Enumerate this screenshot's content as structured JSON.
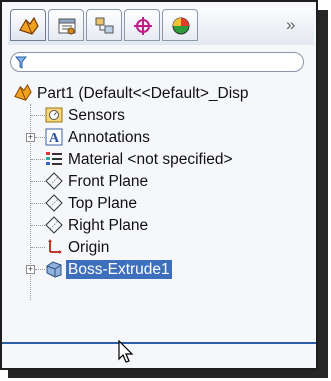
{
  "tabs": [
    {
      "icon": "featuremanager-tree-icon",
      "active": true
    },
    {
      "icon": "propertymanager-icon",
      "active": false
    },
    {
      "icon": "configurationmanager-icon",
      "active": false
    },
    {
      "icon": "dimxpertmanager-icon",
      "active": false
    },
    {
      "icon": "displaymanager-icon",
      "active": false
    }
  ],
  "tab_more": "»",
  "filter": {
    "placeholder": "",
    "icon": "filter-icon"
  },
  "tree": {
    "root": {
      "label": "Part1  (Default<<Default>_Disp",
      "icon": "part-icon"
    },
    "items": [
      {
        "label": "Sensors",
        "icon": "sensors-icon",
        "expandable": false
      },
      {
        "label": "Annotations",
        "icon": "annotations-icon",
        "expandable": true
      },
      {
        "label": "Material <not specified>",
        "icon": "material-icon",
        "expandable": false
      },
      {
        "label": "Front Plane",
        "icon": "plane-icon",
        "expandable": false
      },
      {
        "label": "Top Plane",
        "icon": "plane-icon",
        "expandable": false
      },
      {
        "label": "Right Plane",
        "icon": "plane-icon",
        "expandable": false
      },
      {
        "label": "Origin",
        "icon": "origin-icon",
        "expandable": false
      },
      {
        "label": "Boss-Extrude1",
        "icon": "boss-extrude-icon",
        "expandable": true,
        "selected": true
      }
    ]
  },
  "colors": {
    "selection": "#3e6fbd",
    "rollback_bar": "#2b5ea6",
    "tab_accent": "#c21b8a"
  }
}
